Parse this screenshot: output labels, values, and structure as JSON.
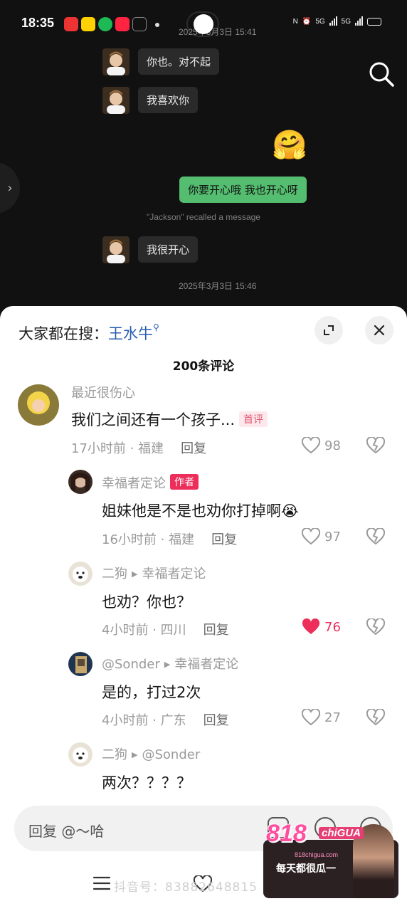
{
  "status_bar": {
    "time": "18:35",
    "app_icons": [
      "meituan-icon",
      "meituan-label-icon",
      "spotify-icon",
      "xiaohongshu-icon",
      "capcut-icon"
    ],
    "network_1": "5G",
    "network_2": "5G"
  },
  "chat": {
    "timestamp_top": "2025年3月3日 15:41",
    "messages": [
      {
        "side": "left",
        "text": "你也。对不起"
      },
      {
        "side": "left",
        "text": "我喜欢你"
      },
      {
        "side": "right",
        "text": "🤗",
        "type": "sticker"
      },
      {
        "side": "right",
        "text": "你要开心哦 我也开心呀"
      },
      {
        "side": "left",
        "text": "我很开心"
      }
    ],
    "recall_notice": "\"Jackson\" recalled a message",
    "timestamp_bottom": "2025年3月3日 15:46"
  },
  "comments_panel": {
    "hot_search_label": "大家都在搜：",
    "hot_search_keyword": "王水牛",
    "count_title": "200条评论",
    "comments": [
      {
        "user": "最近很伤心",
        "text": "我们之间还有一个孩子...",
        "tag": "首评",
        "time_location": "17小时前 · 福建",
        "reply_label": "回复",
        "likes": "98",
        "liked": false
      },
      {
        "user": "幸福者定论",
        "tag": "作者",
        "text": "姐妹他是不是也劝你打掉啊😭",
        "time_location": "16小时前 · 福建",
        "reply_label": "回复",
        "likes": "97",
        "liked": false
      },
      {
        "user": "二狗",
        "reply_to": "幸福者定论",
        "text": "也劝？你也？",
        "time_location": "4小时前 · 四川",
        "reply_label": "回复",
        "likes": "76",
        "liked": true
      },
      {
        "user": "@Sonder",
        "reply_to": "幸福者定论",
        "text": "是的，打过2次",
        "time_location": "4小时前 · 广东",
        "reply_label": "回复",
        "likes": "27",
        "liked": false
      },
      {
        "user": "二狗",
        "reply_to": "@Sonder",
        "text": "两次？？？？"
      }
    ],
    "input_placeholder": "回复 @～哈"
  },
  "promo": {
    "logo": "818",
    "logo_suffix": "chiGUA",
    "site": "818chigua.com",
    "slogan": "每天都很瓜一"
  },
  "watermark": "抖音号：83882648815",
  "colors": {
    "accent_red": "#ee2e5a",
    "chat_bubble_green": "#54bd6f",
    "link_blue": "#2a5db0"
  }
}
